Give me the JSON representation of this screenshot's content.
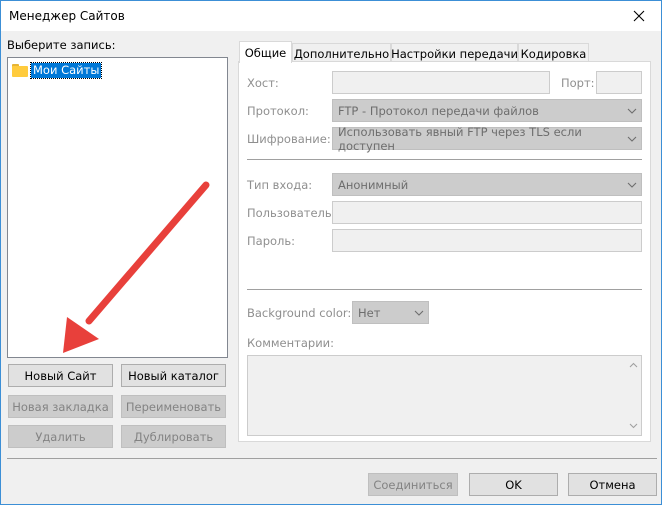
{
  "window": {
    "title": "Менеджер Сайтов"
  },
  "left": {
    "select_label": "Выберите запись:",
    "tree_root": "Мои Сайты",
    "buttons": {
      "new_site": "Новый Сайт",
      "new_folder": "Новый каталог",
      "new_bookmark": "Новая закладка",
      "rename": "Переименовать",
      "delete": "Удалить",
      "duplicate": "Дублировать"
    }
  },
  "tabs": [
    {
      "label": "Общие",
      "active": true
    },
    {
      "label": "Дополнительно",
      "active": false
    },
    {
      "label": "Настройки передачи",
      "active": false
    },
    {
      "label": "Кодировка",
      "active": false
    }
  ],
  "general": {
    "host_label": "Хост:",
    "host_value": "",
    "port_label": "Порт:",
    "port_value": "",
    "protocol_label": "Протокол:",
    "protocol_value": "FTP - Протокол передачи файлов",
    "encryption_label": "Шифрование:",
    "encryption_value": "Использовать явный FTP через TLS если доступен",
    "logon_label": "Тип входа:",
    "logon_value": "Анонимный",
    "user_label": "Пользователь:",
    "user_value": "",
    "password_label": "Пароль:",
    "password_value": "",
    "bgcolor_label": "Background color:",
    "bgcolor_value": "Нет",
    "comments_label": "Комментарии:",
    "comments_value": ""
  },
  "footer": {
    "connect": "Соединиться",
    "ok": "OK",
    "cancel": "Отмена"
  },
  "colors": {
    "accent": "#0078d7",
    "annotation_arrow": "#e8403b"
  },
  "icons": {
    "close": "close-icon",
    "folder": "folder-icon",
    "dropdown": "chevron-down-icon"
  }
}
